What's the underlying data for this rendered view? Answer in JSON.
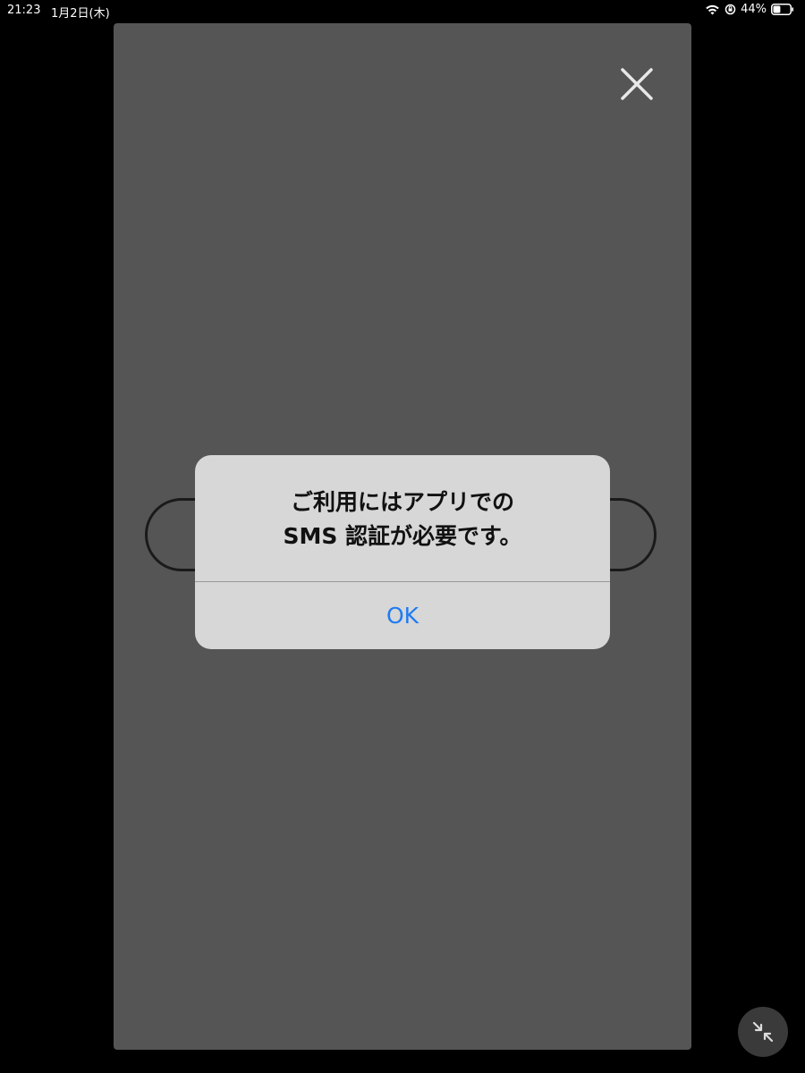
{
  "status_bar": {
    "time": "21:23",
    "date": "1月2日(木)",
    "battery_percent": "44%",
    "battery_level": 0.44,
    "icons": [
      "wifi-icon",
      "orientation-lock-icon",
      "battery-icon"
    ]
  },
  "panel": {
    "close_icon": "close-icon"
  },
  "alert": {
    "message_line1": "ご利用にはアプリでの",
    "message_line2": "SMS 認証が必要です。",
    "ok_label": "OK"
  },
  "floating_button": {
    "icon": "minimize-arrows-icon"
  },
  "colors": {
    "background": "#000000",
    "panel": "#555555",
    "alert_bg": "#d7d7d7",
    "accent": "#1f7bf2"
  }
}
